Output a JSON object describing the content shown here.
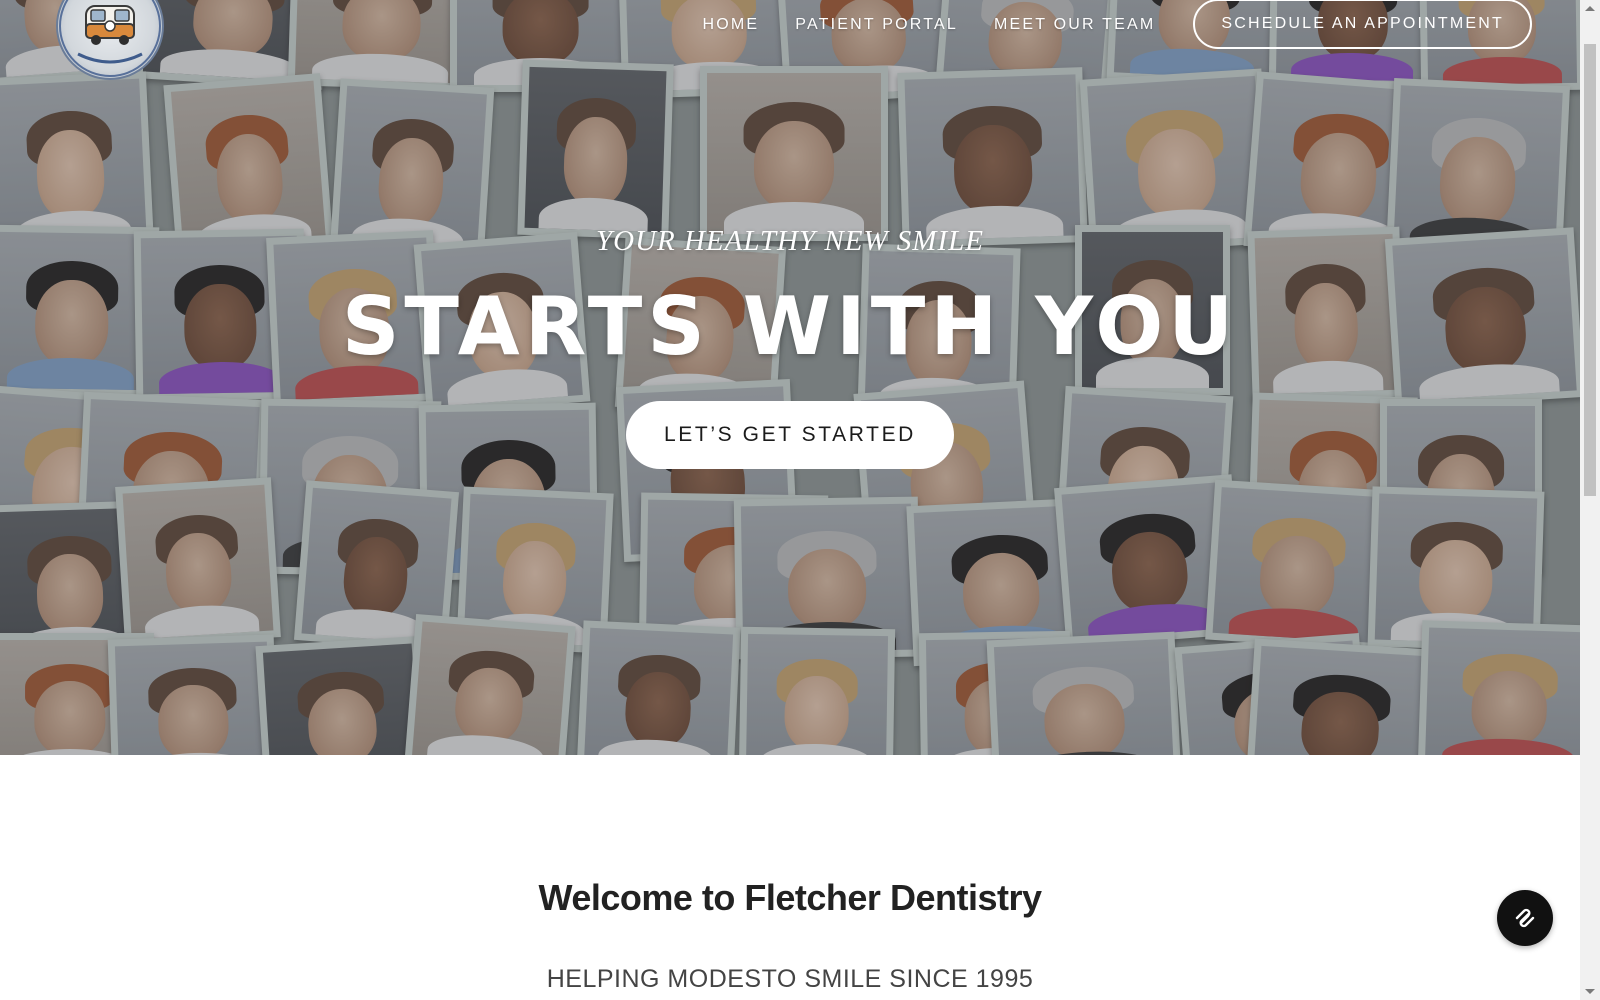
{
  "logo": {
    "alt": "Fletcher Dentistry logo",
    "tagline": "Helping Modesto Smile"
  },
  "nav": {
    "items": [
      {
        "label": "HOME"
      },
      {
        "label": "PATIENT PORTAL"
      },
      {
        "label": "MEET OUR TEAM"
      }
    ],
    "cta_label": "SCHEDULE AN APPOINTMENT"
  },
  "hero": {
    "kicker": "YOUR HEALTHY NEW SMILE",
    "title": "STARTS WITH YOU",
    "button_label": "LET’S GET STARTED"
  },
  "welcome": {
    "title": "Welcome to Fletcher Dentistry",
    "subtitle": "HELPING MODESTO SMILE SINCE 1995"
  },
  "fab": {
    "icon": "squarespace-icon"
  },
  "colors": {
    "hero_overlay": "#464b50",
    "button_bg": "#ffffff",
    "fab_bg": "#111111",
    "text_dark": "#222222"
  }
}
